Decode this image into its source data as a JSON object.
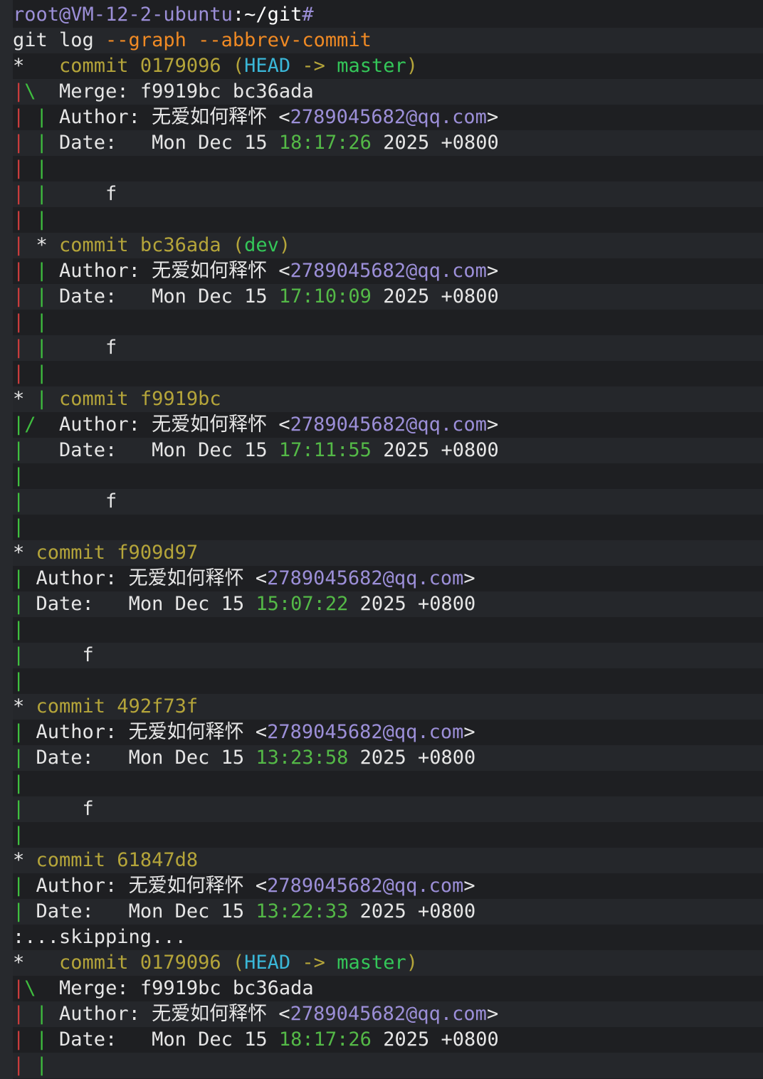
{
  "colors": {
    "prompt_user": "#9c8fd8",
    "prompt_path": "#ffffff",
    "default": "#e6e6e6",
    "option": "#f08a24",
    "commit": "#b5a53a",
    "head": "#3ab7d8",
    "branch": "#34c759",
    "email": "#9c8fd8",
    "time": "#54b947",
    "graph_red": "#c83c3c",
    "graph_green": "#3fbf3f"
  },
  "lines": [
    [
      [
        "root@VM-12-2-ubuntu",
        "prompt_user"
      ],
      [
        ":~/git",
        "prompt_path"
      ],
      [
        "#",
        "prompt_user"
      ]
    ],
    [
      [
        "git log ",
        "default"
      ],
      [
        "--graph --abbrev-commit",
        "option"
      ]
    ],
    [
      [
        "*   ",
        "default"
      ],
      [
        "commit 0179096 (",
        "commit"
      ],
      [
        "HEAD",
        "head"
      ],
      [
        " -> ",
        "commit"
      ],
      [
        "master",
        "branch"
      ],
      [
        ")",
        "commit"
      ]
    ],
    [
      [
        "|",
        "graph_red"
      ],
      [
        "\\",
        "graph_green"
      ],
      [
        "  Merge: f9919bc bc36ada",
        "default"
      ]
    ],
    [
      [
        "|",
        "graph_red"
      ],
      [
        " |",
        "graph_green"
      ],
      [
        " Author: 无爱如何释怀 <",
        "default"
      ],
      [
        "2789045682@qq.com",
        "email"
      ],
      [
        ">",
        "default"
      ]
    ],
    [
      [
        "|",
        "graph_red"
      ],
      [
        " |",
        "graph_green"
      ],
      [
        " Date:   Mon Dec 15 ",
        "default"
      ],
      [
        "18:17:26",
        "time"
      ],
      [
        " 2025 +0800",
        "default"
      ]
    ],
    [
      [
        "|",
        "graph_red"
      ],
      [
        " |",
        "graph_green"
      ]
    ],
    [
      [
        "|",
        "graph_red"
      ],
      [
        " |",
        "graph_green"
      ],
      [
        "     f",
        "default"
      ]
    ],
    [
      [
        "|",
        "graph_red"
      ],
      [
        " |",
        "graph_green"
      ]
    ],
    [
      [
        "|",
        "graph_red"
      ],
      [
        " * ",
        "default"
      ],
      [
        "commit bc36ada (",
        "commit"
      ],
      [
        "dev",
        "branch"
      ],
      [
        ")",
        "commit"
      ]
    ],
    [
      [
        "|",
        "graph_red"
      ],
      [
        " |",
        "graph_green"
      ],
      [
        " Author: 无爱如何释怀 <",
        "default"
      ],
      [
        "2789045682@qq.com",
        "email"
      ],
      [
        ">",
        "default"
      ]
    ],
    [
      [
        "|",
        "graph_red"
      ],
      [
        " |",
        "graph_green"
      ],
      [
        " Date:   Mon Dec 15 ",
        "default"
      ],
      [
        "17:10:09",
        "time"
      ],
      [
        " 2025 +0800",
        "default"
      ]
    ],
    [
      [
        "|",
        "graph_red"
      ],
      [
        " |",
        "graph_green"
      ]
    ],
    [
      [
        "|",
        "graph_red"
      ],
      [
        " |",
        "graph_green"
      ],
      [
        "     f",
        "default"
      ]
    ],
    [
      [
        "|",
        "graph_red"
      ],
      [
        " |",
        "graph_green"
      ]
    ],
    [
      [
        "* ",
        "default"
      ],
      [
        "|",
        "graph_green"
      ],
      [
        " ",
        "default"
      ],
      [
        "commit f9919bc",
        "commit"
      ]
    ],
    [
      [
        "|",
        "graph_green"
      ],
      [
        "/",
        "graph_green"
      ],
      [
        "  Author: 无爱如何释怀 <",
        "default"
      ],
      [
        "2789045682@qq.com",
        "email"
      ],
      [
        ">",
        "default"
      ]
    ],
    [
      [
        "|",
        "graph_green"
      ],
      [
        "   Date:   Mon Dec 15 ",
        "default"
      ],
      [
        "17:11:55",
        "time"
      ],
      [
        " 2025 +0800",
        "default"
      ]
    ],
    [
      [
        "|",
        "graph_green"
      ]
    ],
    [
      [
        "|",
        "graph_green"
      ],
      [
        "       f",
        "default"
      ]
    ],
    [
      [
        "|",
        "graph_green"
      ]
    ],
    [
      [
        "* ",
        "default"
      ],
      [
        "commit f909d97",
        "commit"
      ]
    ],
    [
      [
        "|",
        "graph_green"
      ],
      [
        " Author: 无爱如何释怀 <",
        "default"
      ],
      [
        "2789045682@qq.com",
        "email"
      ],
      [
        ">",
        "default"
      ]
    ],
    [
      [
        "|",
        "graph_green"
      ],
      [
        " Date:   Mon Dec 15 ",
        "default"
      ],
      [
        "15:07:22",
        "time"
      ],
      [
        " 2025 +0800",
        "default"
      ]
    ],
    [
      [
        "|",
        "graph_green"
      ]
    ],
    [
      [
        "|",
        "graph_green"
      ],
      [
        "     f",
        "default"
      ]
    ],
    [
      [
        "|",
        "graph_green"
      ]
    ],
    [
      [
        "* ",
        "default"
      ],
      [
        "commit 492f73f",
        "commit"
      ]
    ],
    [
      [
        "|",
        "graph_green"
      ],
      [
        " Author: 无爱如何释怀 <",
        "default"
      ],
      [
        "2789045682@qq.com",
        "email"
      ],
      [
        ">",
        "default"
      ]
    ],
    [
      [
        "|",
        "graph_green"
      ],
      [
        " Date:   Mon Dec 15 ",
        "default"
      ],
      [
        "13:23:58",
        "time"
      ],
      [
        " 2025 +0800",
        "default"
      ]
    ],
    [
      [
        "|",
        "graph_green"
      ]
    ],
    [
      [
        "|",
        "graph_green"
      ],
      [
        "     f",
        "default"
      ]
    ],
    [
      [
        "|",
        "graph_green"
      ]
    ],
    [
      [
        "* ",
        "default"
      ],
      [
        "commit 61847d8",
        "commit"
      ]
    ],
    [
      [
        "|",
        "graph_green"
      ],
      [
        " Author: 无爱如何释怀 <",
        "default"
      ],
      [
        "2789045682@qq.com",
        "email"
      ],
      [
        ">",
        "default"
      ]
    ],
    [
      [
        "|",
        "graph_green"
      ],
      [
        " Date:   Mon Dec 15 ",
        "default"
      ],
      [
        "13:22:33",
        "time"
      ],
      [
        " 2025 +0800",
        "default"
      ]
    ],
    [
      [
        ":...skipping...",
        "default"
      ]
    ],
    [
      [
        "*   ",
        "default"
      ],
      [
        "commit 0179096 (",
        "commit"
      ],
      [
        "HEAD",
        "head"
      ],
      [
        " -> ",
        "commit"
      ],
      [
        "master",
        "branch"
      ],
      [
        ")",
        "commit"
      ]
    ],
    [
      [
        "|",
        "graph_red"
      ],
      [
        "\\",
        "graph_green"
      ],
      [
        "  Merge: f9919bc bc36ada",
        "default"
      ]
    ],
    [
      [
        "|",
        "graph_red"
      ],
      [
        " |",
        "graph_green"
      ],
      [
        " Author: 无爱如何释怀 <",
        "default"
      ],
      [
        "2789045682@qq.com",
        "email"
      ],
      [
        ">",
        "default"
      ]
    ],
    [
      [
        "|",
        "graph_red"
      ],
      [
        " |",
        "graph_green"
      ],
      [
        " Date:   Mon Dec 15 ",
        "default"
      ],
      [
        "18:17:26",
        "time"
      ],
      [
        " 2025 +0800",
        "default"
      ]
    ],
    [
      [
        "|",
        "graph_red"
      ],
      [
        " |",
        "graph_green"
      ]
    ]
  ]
}
